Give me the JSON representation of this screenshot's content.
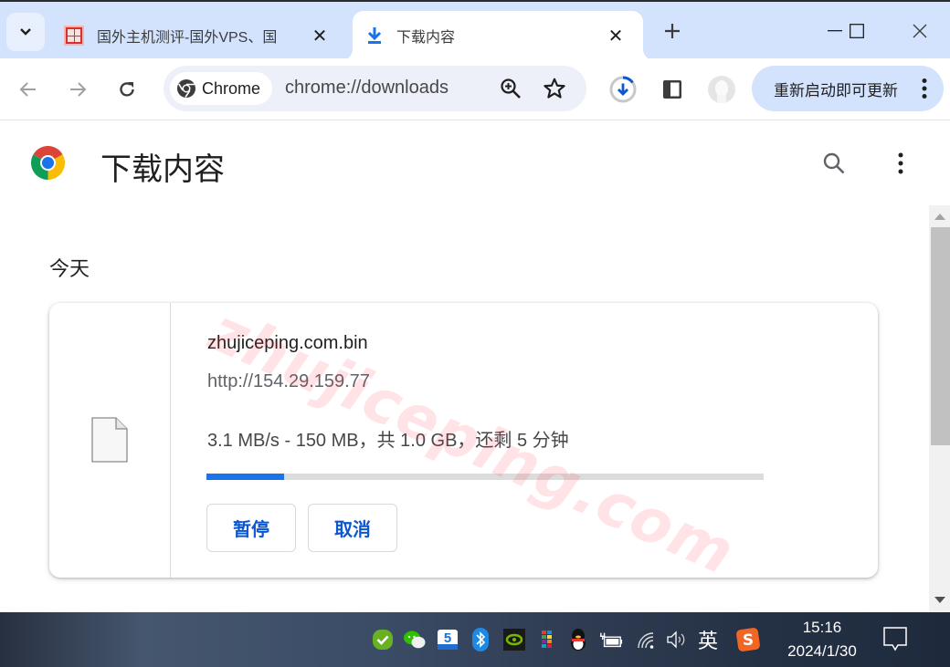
{
  "browser": {
    "tabs": [
      {
        "title": "国外主机测评-国外VPS、国",
        "active": false,
        "icon": "site-favicon"
      },
      {
        "title": "下载内容",
        "active": true,
        "icon": "download-icon"
      }
    ],
    "new_tab_icon": "plus-icon",
    "window_controls": [
      "minimize-icon",
      "maximize-icon",
      "close-icon"
    ],
    "toolbar": {
      "chip_label": "Chrome",
      "url": "chrome://downloads",
      "update_button_label": "重新启动即可更新"
    }
  },
  "page": {
    "title": "下载内容",
    "section_date": "今天",
    "watermark": "zhujiceping.com",
    "download": {
      "file_name": "zhujiceping.com.bin",
      "source_url": "http://154.29.159.77",
      "status": "3.1 MB/s - 150 MB，共 1.0 GB，还剩 5 分钟",
      "progress_percent": 14,
      "pause_label": "暂停",
      "cancel_label": "取消"
    }
  },
  "taskbar": {
    "tray_icons": [
      "security-check-icon",
      "wechat-icon",
      "app-5-icon",
      "bluetooth-icon",
      "nvidia-icon",
      "color-grid-icon",
      "qq-icon",
      "battery-icon",
      "wifi-icon",
      "volume-icon"
    ],
    "ime_label": "英",
    "time": "15:16",
    "date": "2024/1/30"
  },
  "colors": {
    "accent": "#1a73e8",
    "tabstrip": "#d3e3fd",
    "omnibox": "#edf0f9",
    "button_text": "#0b57d0"
  }
}
